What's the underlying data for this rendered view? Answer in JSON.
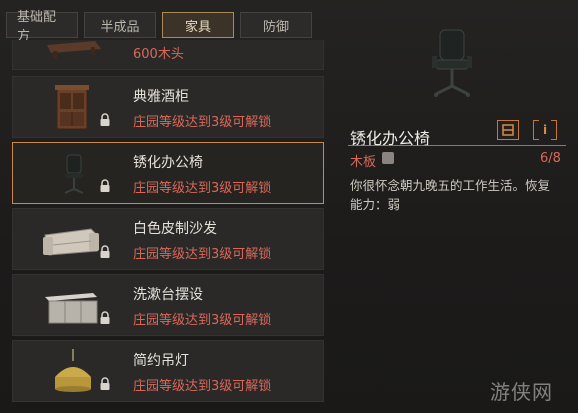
{
  "tabs": [
    {
      "label": "基础配方"
    },
    {
      "label": "半成品"
    },
    {
      "label": "家具"
    },
    {
      "label": "防御"
    }
  ],
  "list": {
    "partial_item": {
      "requirement": "600木头"
    },
    "items": [
      {
        "name": "典雅酒柜",
        "requirement": "庄园等级达到3级可解锁",
        "icon": "wine-cabinet-icon"
      },
      {
        "name": "锈化办公椅",
        "requirement": "庄园等级达到3级可解锁",
        "icon": "office-chair-icon",
        "selected": true
      },
      {
        "name": "白色皮制沙发",
        "requirement": "庄园等级达到3级可解锁",
        "icon": "sofa-icon"
      },
      {
        "name": "洗漱台摆设",
        "requirement": "庄园等级达到3级可解锁",
        "icon": "washstand-icon"
      },
      {
        "name": "简约吊灯",
        "requirement": "庄园等级达到3级可解锁",
        "icon": "pendant-lamp-icon"
      }
    ]
  },
  "detail": {
    "title": "锈化办公椅",
    "icon_buttons": [
      "build-icon",
      "info-icon"
    ],
    "info_glyph": "i",
    "material": {
      "name": "木板",
      "count": "6/8"
    },
    "description": "你很怀念朝九晚五的工作生活。恢复能力：弱"
  },
  "watermark": "游侠网",
  "colors": {
    "accent": "#c9894a",
    "requirement_red": "#d9685a",
    "background": "#1d1c1c"
  }
}
